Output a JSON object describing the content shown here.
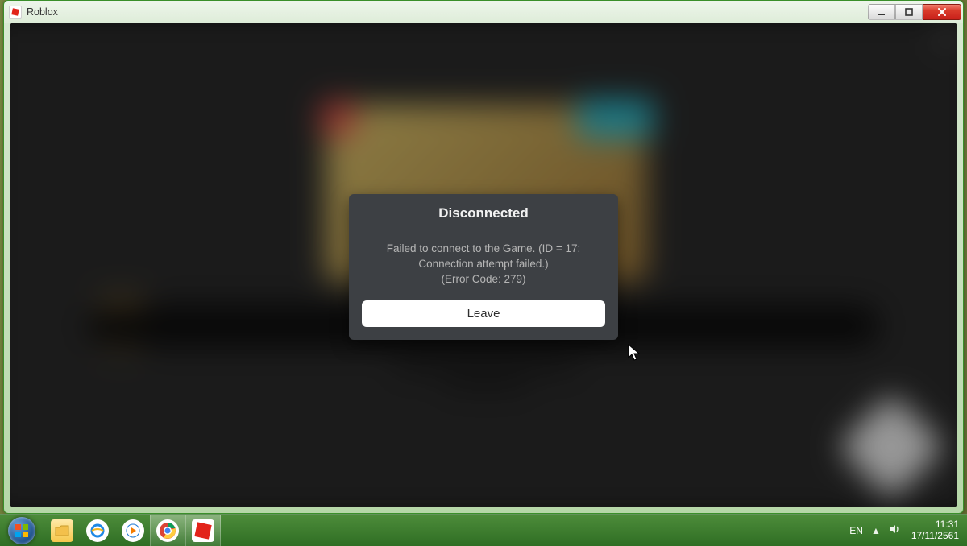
{
  "window": {
    "title": "Roblox"
  },
  "dialog": {
    "title": "Disconnected",
    "message_line1": "Failed to connect to the Game. (ID = 17: Connection attempt failed.)",
    "message_line2": "(Error Code: 279)",
    "leave_label": "Leave"
  },
  "taskbar": {
    "lang": "EN",
    "time": "11:31",
    "date": "17/11/2561"
  }
}
